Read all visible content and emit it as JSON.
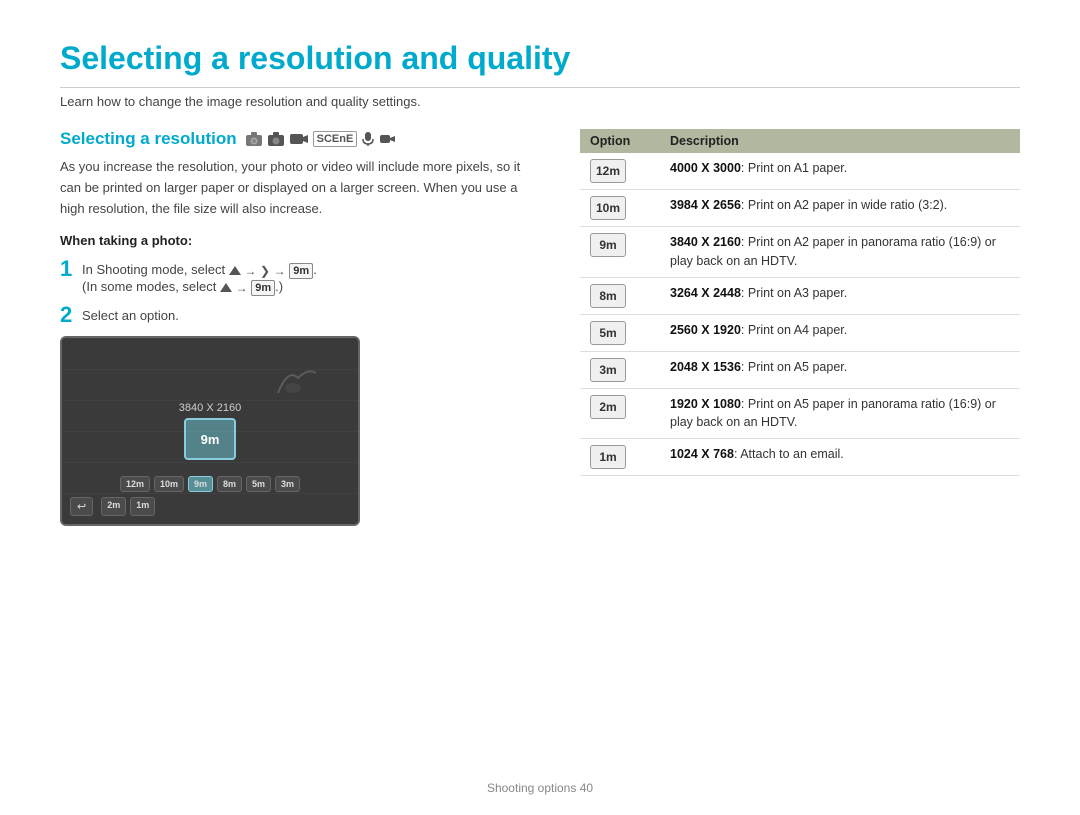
{
  "page": {
    "title": "Selecting a resolution and quality",
    "subtitle": "Learn how to change the image resolution and quality settings.",
    "footer": "Shooting options  40"
  },
  "section_resolution": {
    "heading": "Selecting a resolution",
    "body": "As you increase the resolution, your photo or video will include more pixels, so it can be printed on larger paper or displayed on a larger screen. When you use a high resolution, the file size will also increase.",
    "when_taking_heading": "When taking a photo:",
    "step1_text": "In Shooting mode, select",
    "step1_sub": "(In some modes, select",
    "step2_text": "Select an option.",
    "screen_label": "3840 X 2160",
    "screen_selected": "9m",
    "icon_row": [
      "12m",
      "10m",
      "9m",
      "8m",
      "5m",
      "3m"
    ],
    "icon_row2": [
      "2m",
      "1m"
    ]
  },
  "table": {
    "col_option": "Option",
    "col_description": "Description",
    "rows": [
      {
        "icon": "12m",
        "bold": "4000 X 3000",
        "desc": ": Print on A1 paper."
      },
      {
        "icon": "10m",
        "bold": "3984 X 2656",
        "desc": ": Print on A2 paper in wide ratio (3:2)."
      },
      {
        "icon": "9m",
        "bold": "3840 X 2160",
        "desc": ": Print on A2 paper in panorama ratio (16:9) or play back on an HDTV."
      },
      {
        "icon": "8m",
        "bold": "3264 X 2448",
        "desc": ": Print on A3 paper."
      },
      {
        "icon": "5m",
        "bold": "2560 X 1920",
        "desc": ": Print on A4 paper."
      },
      {
        "icon": "3m",
        "bold": "2048 X 1536",
        "desc": ": Print on A5 paper."
      },
      {
        "icon": "2m",
        "bold": "1920 X 1080",
        "desc": ": Print on A5 paper in panorama ratio (16:9) or play back on an HDTV.",
        "panorama": true
      },
      {
        "icon": "1m",
        "bold": "1024 X 768",
        "desc": ": Attach to an email."
      }
    ]
  }
}
